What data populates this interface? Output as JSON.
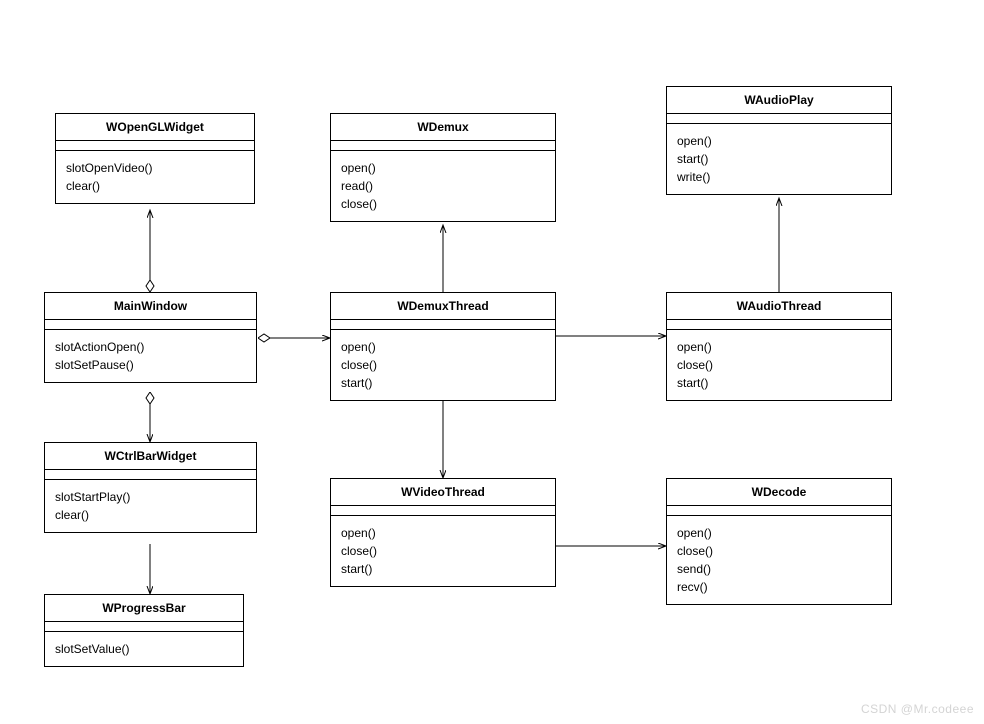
{
  "classes": {
    "wopenglwidget": {
      "name": "WOpenGLWidget",
      "methods": [
        "slotOpenVideo()",
        "clear()"
      ]
    },
    "mainwindow": {
      "name": "MainWindow",
      "methods": [
        "slotActionOpen()",
        "slotSetPause()"
      ]
    },
    "wctrlbarwidget": {
      "name": "WCtrlBarWidget",
      "methods": [
        "slotStartPlay()",
        "clear()"
      ]
    },
    "wprogressbar": {
      "name": "WProgressBar",
      "methods": [
        "slotSetValue()"
      ]
    },
    "wdemux": {
      "name": "WDemux",
      "methods": [
        "open()",
        "read()",
        "close()"
      ]
    },
    "wdemuxthread": {
      "name": "WDemuxThread",
      "methods": [
        "open()",
        "close()",
        "start()"
      ]
    },
    "wvideothread": {
      "name": "WVideoThread",
      "methods": [
        "open()",
        "close()",
        "start()"
      ]
    },
    "waudioplay": {
      "name": "WAudioPlay",
      "methods": [
        "open()",
        "start()",
        "write()"
      ]
    },
    "waudiothread": {
      "name": "WAudioThread",
      "methods": [
        "open()",
        "close()",
        "start()"
      ]
    },
    "wdecode": {
      "name": "WDecode",
      "methods": [
        "open()",
        "close()",
        "send()",
        "recv()"
      ]
    }
  },
  "watermark": "CSDN @Mr.codeee",
  "chart_data": {
    "type": "diagram",
    "title": "",
    "nodes": [
      {
        "id": "WOpenGLWidget",
        "methods": [
          "slotOpenVideo()",
          "clear()"
        ]
      },
      {
        "id": "MainWindow",
        "methods": [
          "slotActionOpen()",
          "slotSetPause()"
        ]
      },
      {
        "id": "WCtrlBarWidget",
        "methods": [
          "slotStartPlay()",
          "clear()"
        ]
      },
      {
        "id": "WProgressBar",
        "methods": [
          "slotSetValue()"
        ]
      },
      {
        "id": "WDemux",
        "methods": [
          "open()",
          "read()",
          "close()"
        ]
      },
      {
        "id": "WDemuxThread",
        "methods": [
          "open()",
          "close()",
          "start()"
        ]
      },
      {
        "id": "WVideoThread",
        "methods": [
          "open()",
          "close()",
          "start()"
        ]
      },
      {
        "id": "WAudioPlay",
        "methods": [
          "open()",
          "start()",
          "write()"
        ]
      },
      {
        "id": "WAudioThread",
        "methods": [
          "open()",
          "close()",
          "start()"
        ]
      },
      {
        "id": "WDecode",
        "methods": [
          "open()",
          "close()",
          "send()",
          "recv()"
        ]
      }
    ],
    "edges": [
      {
        "from": "MainWindow",
        "to": "WOpenGLWidget",
        "relation": "aggregation"
      },
      {
        "from": "MainWindow",
        "to": "WCtrlBarWidget",
        "relation": "aggregation"
      },
      {
        "from": "MainWindow",
        "to": "WDemuxThread",
        "relation": "association"
      },
      {
        "from": "WCtrlBarWidget",
        "to": "WProgressBar",
        "relation": "association"
      },
      {
        "from": "WDemuxThread",
        "to": "WDemux",
        "relation": "association"
      },
      {
        "from": "WDemuxThread",
        "to": "WAudioThread",
        "relation": "association"
      },
      {
        "from": "WDemuxThread",
        "to": "WVideoThread",
        "relation": "association"
      },
      {
        "from": "WAudioThread",
        "to": "WAudioPlay",
        "relation": "association"
      },
      {
        "from": "WVideoThread",
        "to": "WDecode",
        "relation": "association"
      }
    ]
  }
}
